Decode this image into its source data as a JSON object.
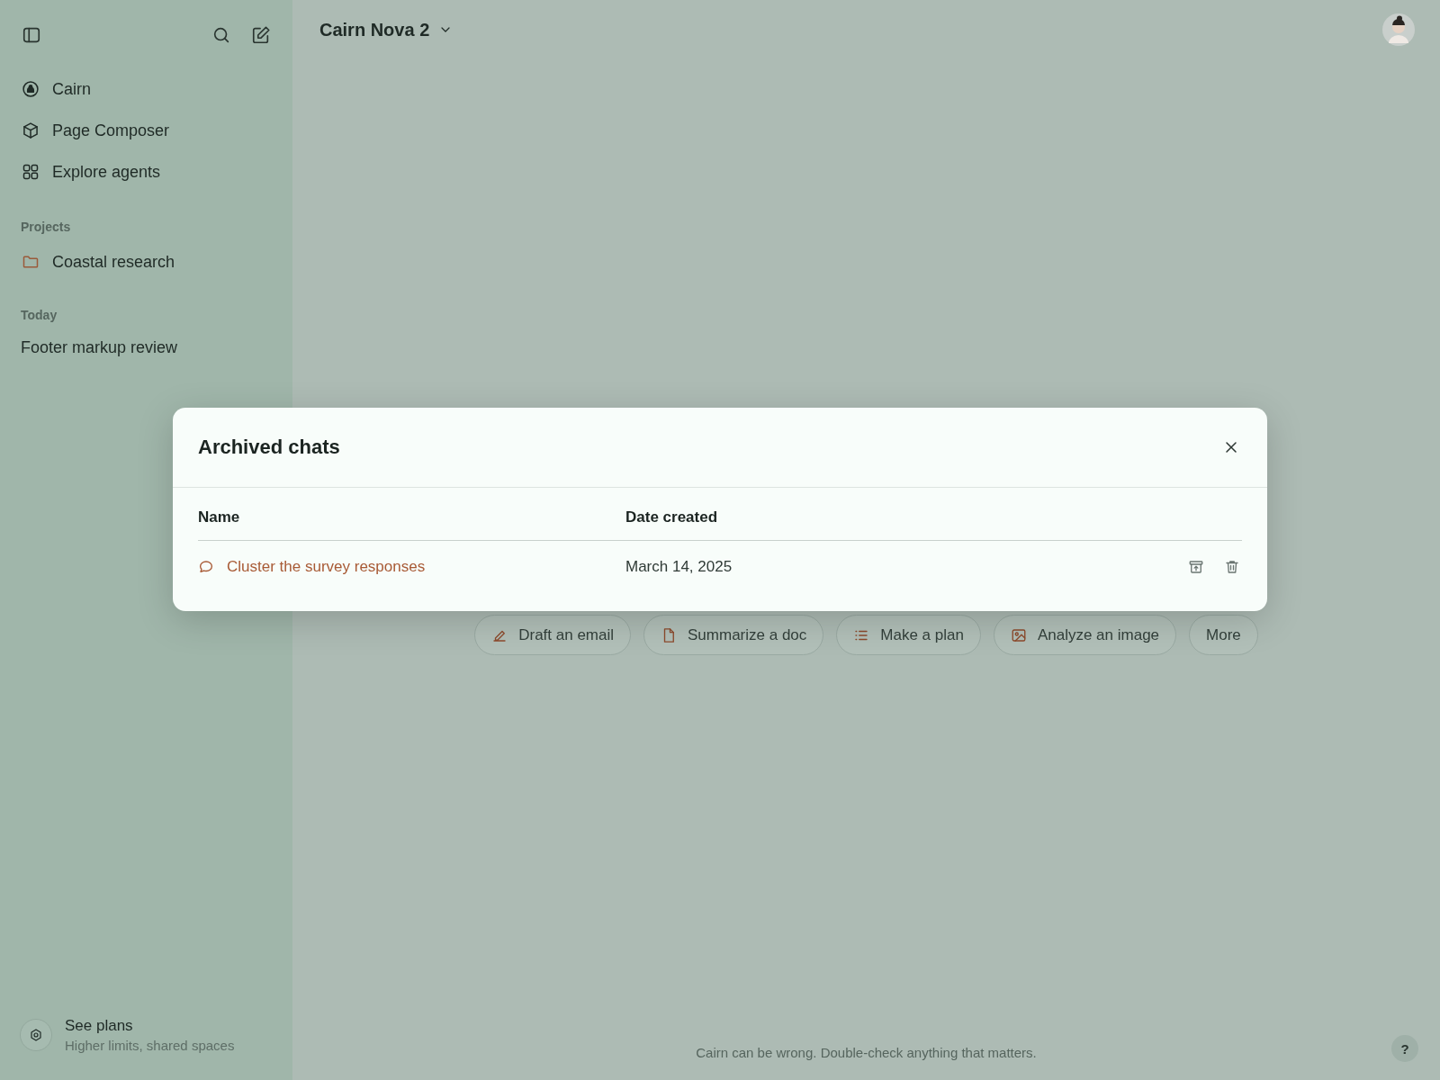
{
  "sidebar": {
    "nav": [
      {
        "kind": "cairn",
        "label": "Cairn"
      },
      {
        "kind": "cube",
        "label": "Page Composer"
      },
      {
        "kind": "grid",
        "label": "Explore agents"
      }
    ],
    "projects": {
      "heading": "Projects",
      "items": [
        {
          "label": "Coastal research"
        }
      ]
    },
    "today": {
      "heading": "Today",
      "items": [
        {
          "label": "Footer markup review"
        }
      ]
    },
    "plans": {
      "title": "See plans",
      "subtitle": "Higher limits, shared spaces"
    }
  },
  "header": {
    "model": "Cairn Nova 2"
  },
  "chips": [
    {
      "kind": "pen",
      "label": "Draft an email"
    },
    {
      "kind": "doc",
      "label": "Summarize a doc"
    },
    {
      "kind": "list",
      "label": "Make a plan"
    },
    {
      "kind": "image",
      "label": "Analyze an image"
    },
    {
      "kind": "none",
      "label": "More"
    }
  ],
  "footer": {
    "note": "Cairn can be wrong. Double-check anything that matters.",
    "help": "?"
  },
  "modal": {
    "title": "Archived chats",
    "columns": [
      "Name",
      "Date created"
    ],
    "rows": [
      {
        "name": "Cluster the survey responses",
        "date": "March 14, 2025"
      }
    ]
  }
}
